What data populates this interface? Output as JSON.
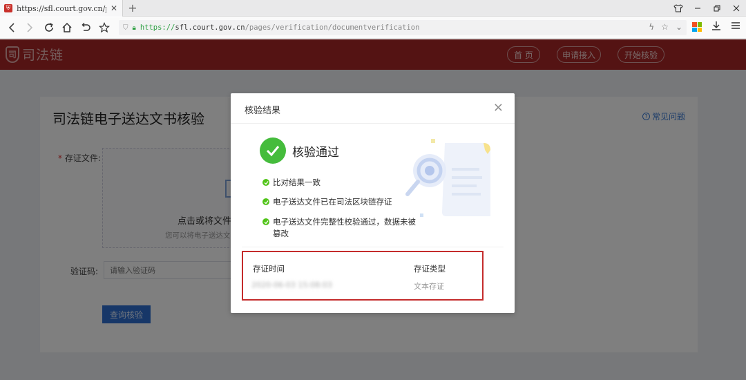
{
  "browser": {
    "tab_title": "https://sfl.court.gov.cn/p",
    "url_proto": "https://",
    "url_host": "sfl.court.gov.cn",
    "url_path": "/pages/verification/documentverification"
  },
  "header": {
    "logo_mark": "司",
    "logo_text": "司法链",
    "nav": [
      "首 页",
      "申请接入",
      "开始核验"
    ]
  },
  "page": {
    "title": "司法链电子送达文书核验",
    "faq": "常见问题",
    "file_label": "存证文件:",
    "required_mark": "*",
    "upload_text": "点击或将文件",
    "upload_hint": "您可以将电子送达文",
    "code_label": "验证码:",
    "code_placeholder": "请输入验证码",
    "query_button": "查询核验"
  },
  "modal": {
    "title": "核验结果",
    "close": "×",
    "result_title": "核验通过",
    "items": [
      "比对结果一致",
      "电子送达文件已在司法区块链存证",
      "电子送达文件完整性校验通过，数据未被篡改"
    ],
    "info": {
      "time_label": "存证时间",
      "time_value": "2020-06-03 15:08:03",
      "type_label": "存证类型",
      "type_value": "文本存证"
    }
  },
  "colors": {
    "brand_red": "#a82727",
    "success_green": "#45bc3c",
    "link_blue": "#3a7bd5",
    "highlight_box": "#c42b2b"
  }
}
